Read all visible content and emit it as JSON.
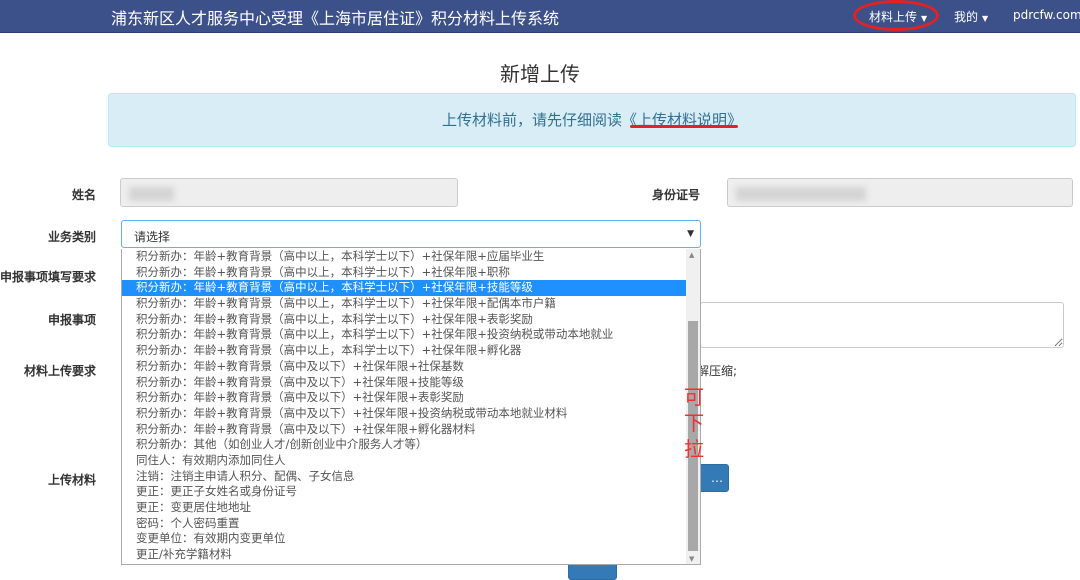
{
  "navbar": {
    "brand": "浦东新区人才服务中心受理《上海市居住证》积分材料上传系统",
    "items": [
      {
        "label": "材料上传"
      },
      {
        "label": "我的"
      },
      {
        "label": "pdrcfw.com"
      }
    ]
  },
  "page_title": "新增上传",
  "alert": {
    "prefix": "上传材料前，请先仔细阅读",
    "link": "《上传材料说明》"
  },
  "form": {
    "name_label": "姓名",
    "id_label": "身份证号",
    "category_label": "业务类别",
    "category_value": "请选择",
    "req_label": "申报事项填写要求",
    "item_label": "申报事项",
    "upload_req_label": "材料上传要求",
    "upload_req_fragment": "解压缩;",
    "upload_label": "上传材料",
    "browse_button": "…"
  },
  "dropdown_options": [
    "积分新办：年龄+教育背景（高中以上，本科学士以下）+社保年限+应届毕业生",
    "积分新办：年龄+教育背景（高中以上，本科学士以下）+社保年限+职称",
    "积分新办：年龄+教育背景（高中以上，本科学士以下）+社保年限+技能等级",
    "积分新办：年龄+教育背景（高中以上，本科学士以下）+社保年限+配偶本市户籍",
    "积分新办：年龄+教育背景（高中以上，本科学士以下）+社保年限+表彰奖励",
    "积分新办：年龄+教育背景（高中以上，本科学士以下）+社保年限+投资纳税或带动本地就业",
    "积分新办：年龄+教育背景（高中以上，本科学士以下）+社保年限+孵化器",
    "积分新办：年龄+教育背景（高中及以下）+社保年限+社保基数",
    "积分新办：年龄+教育背景（高中及以下）+社保年限+技能等级",
    "积分新办：年龄+教育背景（高中及以下）+社保年限+表彰奖励",
    "积分新办：年龄+教育背景（高中及以下）+社保年限+投资纳税或带动本地就业材料",
    "积分新办：年龄+教育背景（高中及以下）+社保年限+孵化器材料",
    "积分新办：其他（如创业人才/创新创业中介服务人才等）",
    "同住人：有效期内添加同住人",
    "注销：注销主申请人积分、配偶、子女信息",
    "更正：更正子女姓名或身份证号",
    "更正：变更居住地地址",
    "密码：个人密码重置",
    "变更单位：有效期内变更单位",
    "更正/补充学籍材料"
  ],
  "selected_index": 2,
  "annotation": "可下拉"
}
